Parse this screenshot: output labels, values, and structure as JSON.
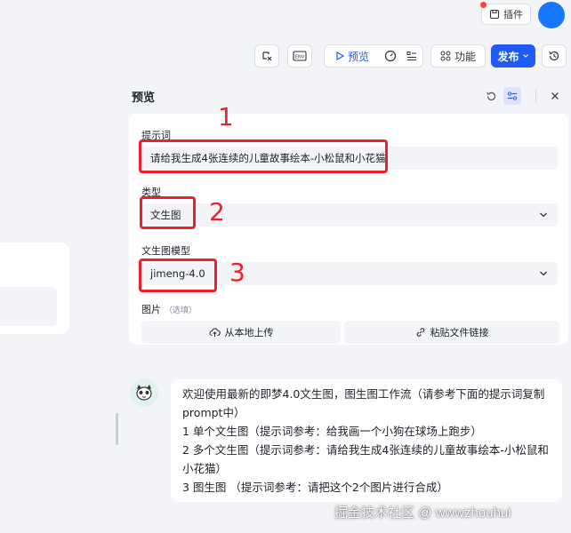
{
  "topbar": {
    "plugin_label": "插件"
  },
  "toolbar": {
    "preview_label": "预览",
    "function_label": "功能",
    "publish_label": "发布"
  },
  "panel": {
    "title": "预览",
    "prompt_label": "提示词",
    "prompt_value": "请给我生成4张连续的儿童故事绘本-小松鼠和小花猫",
    "type_label": "类型",
    "type_value": "文生图",
    "model_label": "文生图模型",
    "model_value": "jimeng-4.0",
    "image_label": "图片",
    "image_optional": "（选填）",
    "upload_local": "从本地上传",
    "paste_link": "粘贴文件链接"
  },
  "annotations": [
    "1",
    "2",
    "3"
  ],
  "message": {
    "lines": [
      "欢迎使用最新的即梦4.0文生图，图生图工作流（请参考下面的提示词复制prompt中）",
      "1 单个文生图（提示词参考：给我画一个小狗在球场上跑步）",
      "2 多个文生图（提示词参考：请给我生成4张连续的儿童故事绘本-小松鼠和小花猫）",
      "3 图生图 （提示词参考：请把这个2个图片进行合成）"
    ]
  },
  "watermark": "掘金技术社区 @ wwwzhouhui",
  "colors": {
    "primary": "#1e5bf5",
    "annotation": "#e8212b",
    "background": "#f3f4f7"
  }
}
